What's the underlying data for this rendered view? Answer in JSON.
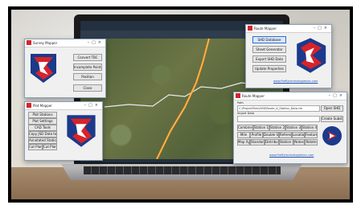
{
  "survey_mapper": {
    "title": "Survey Mapper",
    "buttons": [
      "Convert TBC",
      "Incomplete Points",
      "Position",
      "Close"
    ]
  },
  "plot_mapper": {
    "title": "Plot Mapper",
    "buttons": [
      "Plot Stations",
      "Plot Settings",
      "CAD Tools",
      "Copy JSD Data to Border",
      "Annotated Station Tool",
      "Cut Plan",
      "Cut Plan"
    ]
  },
  "route_mapper": {
    "title": "Route Mapper",
    "buttons": [
      "SHD Database",
      "Sheet Generator",
      "Export SHD Data",
      "Update Properties"
    ],
    "link": "www.fireflytechnologiesinc.com"
  },
  "small_window": {
    "title": "Route Mapper",
    "label_top": "Path",
    "path_value": "C:\\ProjectFiles\\SHD\\Route_A_Station_Data.rte",
    "open_label": "Open SHD",
    "label_mid": "Import Data",
    "import_label": "Create Substation",
    "grid_rows": [
      [
        "Combine Sheets",
        "Station 1",
        "Station 2",
        "Station 3",
        "Station 4"
      ],
      [
        "Mile",
        "Profile",
        "Double Station",
        "Reference",
        "Locations",
        "Features"
      ],
      [
        "Map Xyz",
        "Standard Grid",
        "Distribution",
        "Station Mark",
        "Notes",
        "Rotate"
      ]
    ],
    "link": "www.fireflytechnologiesinc.com"
  }
}
